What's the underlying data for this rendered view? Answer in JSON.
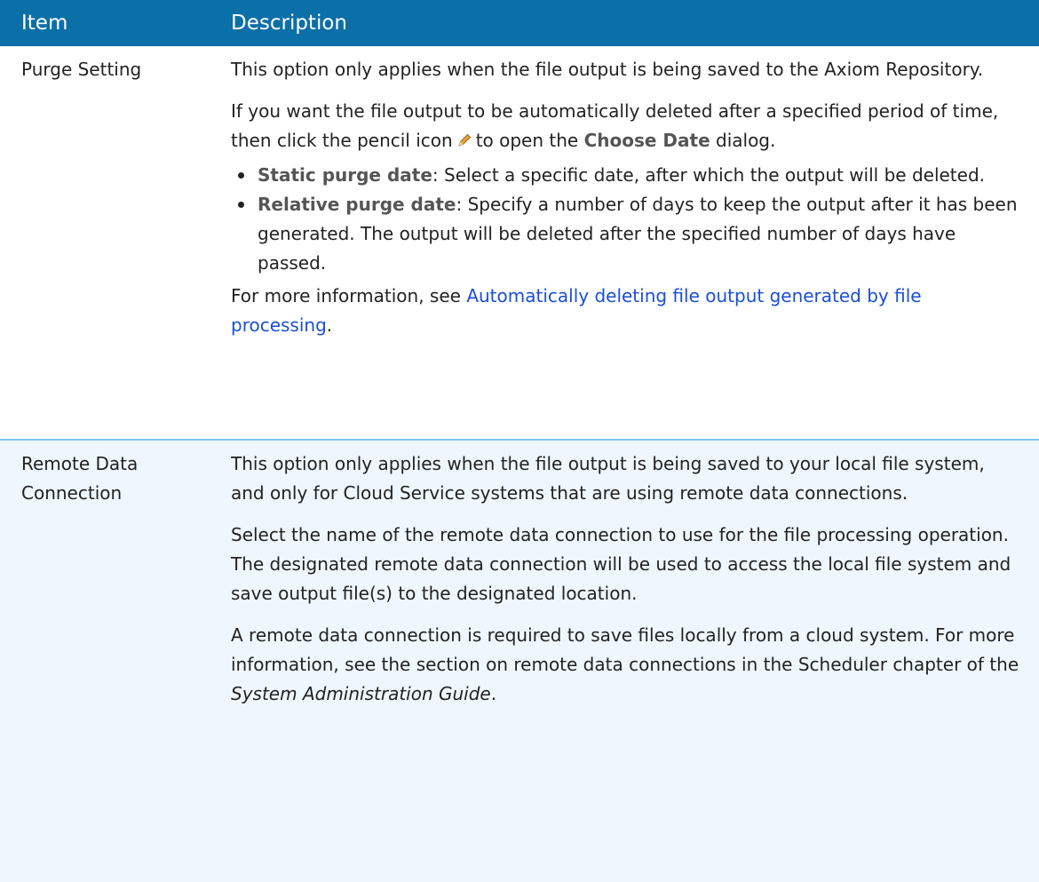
{
  "header": {
    "item": "Item",
    "description": "Description"
  },
  "rows": [
    {
      "item": "Purge Setting",
      "para1": "This option only applies when the file output is being saved to the Axiom Repository.",
      "para2_before": "If you want the file output to be automatically deleted after a specified period of time, then click the pencil icon",
      "para2_middle": "to open the",
      "para2_label": "Choose Date",
      "para2_after": "dialog.",
      "bullets": [
        {
          "label": "Static purge date",
          "text": ": Select a specific date, after which the output will be deleted."
        },
        {
          "label": "Relative purge date",
          "text": ": Specify a number of days to keep the output after it has been generated. The output will be deleted after the specified number of days have passed."
        }
      ],
      "para3_before": "For more information, see",
      "para3_link": "Automatically deleting file output generated by file processing",
      "para3_after": "."
    },
    {
      "item": "Remote Data Connection",
      "para1": "This option only applies when the file output is being saved to your local file system, and only for Cloud Service systems that are using remote data connections.",
      "para2": "Select the name of the remote data connection to use for the file processing operation. The designated remote data connection will be used to access the local file system and save output file(s) to the designated location.",
      "para3_before": "A remote data connection is required to save files locally from a cloud system. For more information, see the section on remote data connections in the Scheduler chapter of the",
      "para3_italic": "System Administration Guide",
      "para3_after": "."
    }
  ],
  "colors": {
    "header_bg": "#0b6fa8",
    "row_alt_bg": "#eef7fd",
    "link": "#1a4fd6",
    "divider": "#7ec6ea"
  },
  "icons": {
    "pencil": "pencil-icon"
  }
}
